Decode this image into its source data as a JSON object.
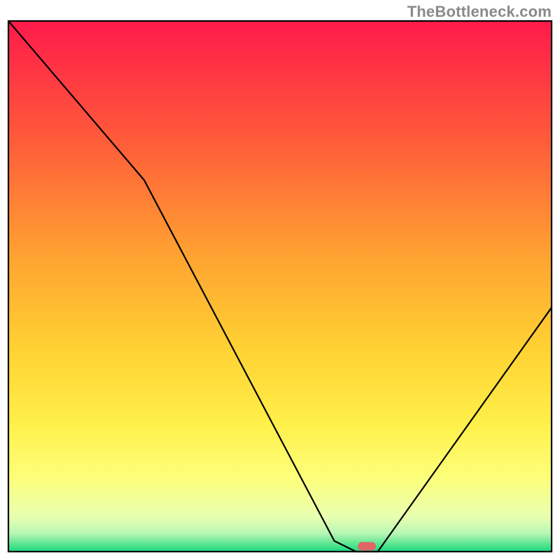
{
  "watermark": "TheBottleneck.com",
  "chart_data": {
    "type": "line",
    "title": "",
    "xlabel": "",
    "ylabel": "",
    "xlim": [
      0,
      100
    ],
    "ylim": [
      0,
      100
    ],
    "x": [
      0,
      25,
      60,
      64,
      68,
      100
    ],
    "values": [
      100,
      70,
      2,
      0,
      0,
      46
    ],
    "marker": {
      "x": 66,
      "y": 1
    },
    "gradient_stops": [
      {
        "offset": 0.0,
        "color": "#ff1a4b"
      },
      {
        "offset": 0.22,
        "color": "#ff5a3a"
      },
      {
        "offset": 0.45,
        "color": "#ffa531"
      },
      {
        "offset": 0.62,
        "color": "#ffd233"
      },
      {
        "offset": 0.76,
        "color": "#fff04a"
      },
      {
        "offset": 0.86,
        "color": "#fdff7a"
      },
      {
        "offset": 0.935,
        "color": "#e7ffb0"
      },
      {
        "offset": 0.965,
        "color": "#b9f7b4"
      },
      {
        "offset": 0.985,
        "color": "#5ee693"
      },
      {
        "offset": 1.0,
        "color": "#18d87f"
      }
    ],
    "frame_color": "#000000",
    "curve_color": "#000000",
    "marker_color": "#e06666",
    "background": "#ffffff"
  }
}
